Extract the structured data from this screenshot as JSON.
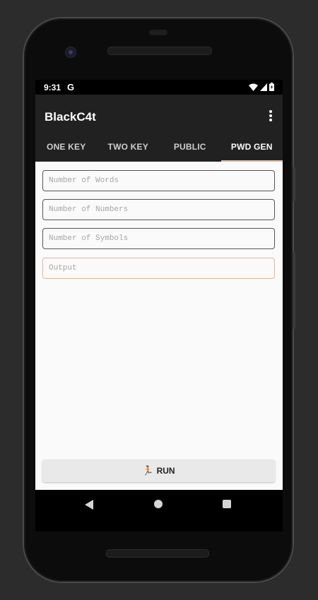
{
  "status_bar": {
    "time": "9:31",
    "g_icon": "G"
  },
  "app_bar": {
    "title": "BlackC4t",
    "overflow_icon": "more-vertical-icon"
  },
  "tabs": [
    {
      "label": "ONE KEY",
      "active": false
    },
    {
      "label": "TWO KEY",
      "active": false
    },
    {
      "label": "PUBLIC",
      "active": false
    },
    {
      "label": "PWD GEN",
      "active": true
    }
  ],
  "form": {
    "words_placeholder": "Number of Words",
    "numbers_placeholder": "Number of Numbers",
    "symbols_placeholder": "Number of Symbols",
    "output_placeholder": "Output"
  },
  "run_button": {
    "icon": "🏃",
    "label": "RUN"
  },
  "colors": {
    "app_bar": "#212121",
    "accent": "#e0b6a0",
    "content_bg": "#fafafa"
  },
  "nav_bar": {
    "back_icon": "back-triangle-icon",
    "home_icon": "home-circle-icon",
    "recents_icon": "recents-square-icon"
  }
}
